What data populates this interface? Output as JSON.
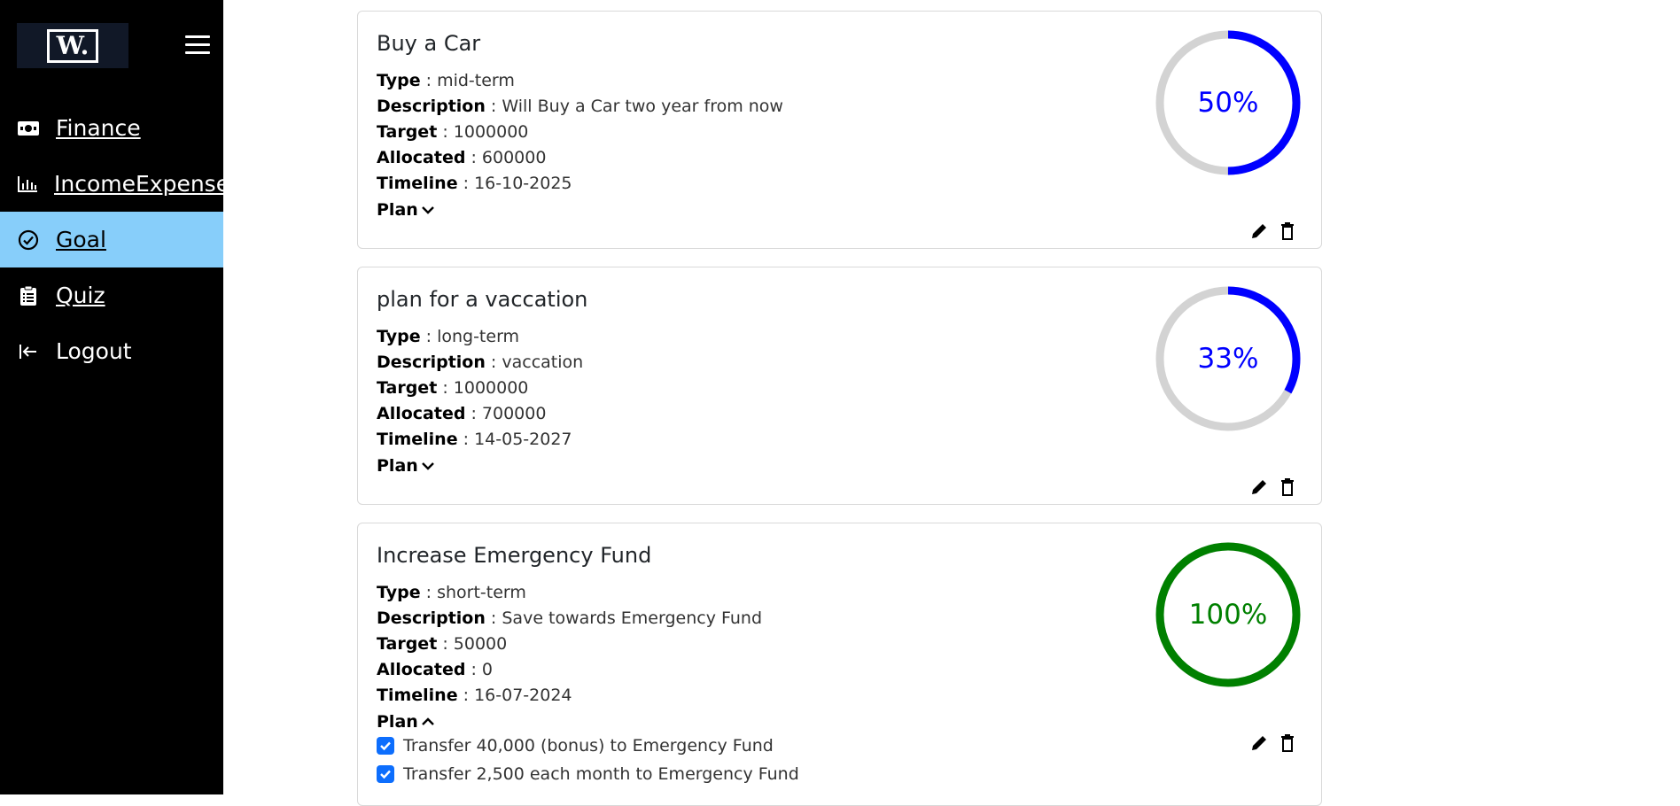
{
  "brand": {
    "logo_text": "W."
  },
  "sidebar": {
    "items": [
      {
        "label": "Finance",
        "icon": "cash-icon"
      },
      {
        "label": "IncomeExpense",
        "icon": "bar-chart-icon"
      },
      {
        "label": "Goal",
        "icon": "check-circle-icon",
        "active": true
      },
      {
        "label": "Quiz",
        "icon": "clipboard-icon"
      },
      {
        "label": "Logout",
        "icon": "logout-icon"
      }
    ]
  },
  "labels": {
    "type": "Type",
    "description": "Description",
    "target": "Target",
    "allocated": "Allocated",
    "timeline": "Timeline",
    "plan": "Plan",
    "separator": " : "
  },
  "goals": [
    {
      "title": "Buy a Car",
      "type": "mid-term",
      "description": "Will Buy a Car two year from now",
      "target": "1000000",
      "allocated": "600000",
      "timeline": "16-10-2025",
      "progress_label": "50%",
      "progress_value": 0.5,
      "progress_color": "#0000ff",
      "plan_expanded": false
    },
    {
      "title": "plan for a vaccation",
      "type": "long-term",
      "description": "vaccation",
      "target": "1000000",
      "allocated": "700000",
      "timeline": "14-05-2027",
      "progress_label": "33%",
      "progress_value": 0.33,
      "progress_color": "#0000ff",
      "plan_expanded": false
    },
    {
      "title": "Increase Emergency Fund",
      "type": "short-term",
      "description": "Save towards Emergency Fund",
      "target": "50000",
      "allocated": "0",
      "timeline": "16-07-2024",
      "progress_label": "100%",
      "progress_value": 1.0,
      "progress_color": "#008000",
      "plan_expanded": true,
      "plan_steps": [
        {
          "text": "Transfer 40,000 (bonus) to Emergency Fund",
          "checked": true
        },
        {
          "text": "Transfer 2,500 each month to Emergency Fund",
          "checked": true
        }
      ]
    }
  ],
  "colors": {
    "sidebar_bg": "#000000",
    "active_nav_bg": "#87cefa",
    "checkbox": "#0d6efd",
    "ring_track": "#d3d3d3"
  }
}
